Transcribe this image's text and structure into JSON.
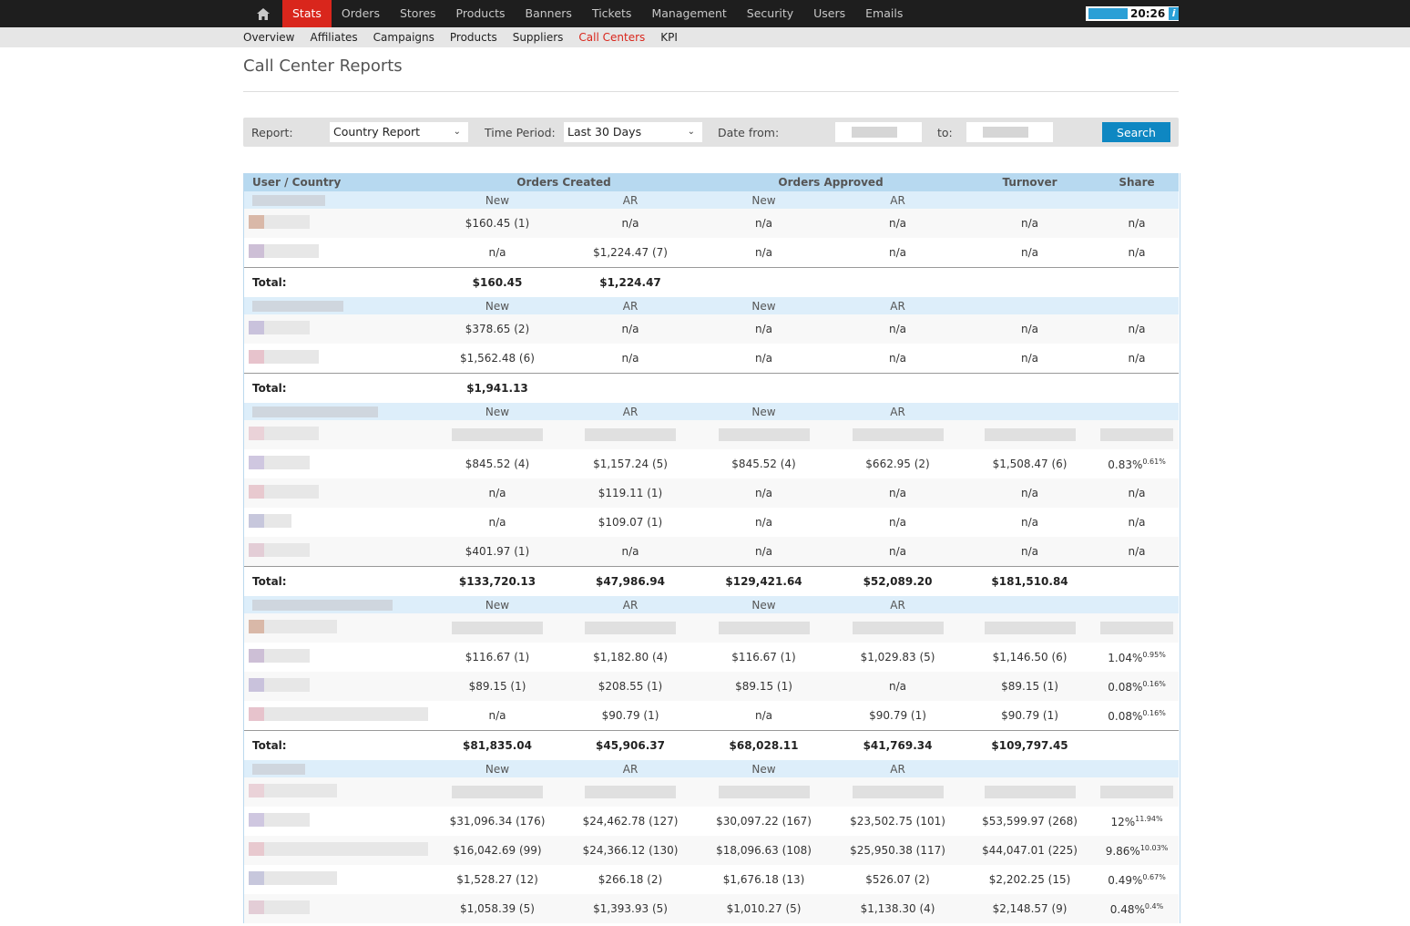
{
  "nav": {
    "items": [
      "Stats",
      "Orders",
      "Stores",
      "Products",
      "Banners",
      "Tickets",
      "Management",
      "Security",
      "Users",
      "Emails"
    ],
    "clock": "20:26",
    "info": "i"
  },
  "subnav": {
    "items": [
      "Overview",
      "Affiliates",
      "Campaigns",
      "Products",
      "Suppliers",
      "Call Centers",
      "KPI"
    ]
  },
  "page_title": "Call Center Reports",
  "filters": {
    "report_label": "Report:",
    "report_value": "Country Report",
    "period_label": "Time Period:",
    "period_value": "Last 30 Days",
    "date_from_label": "Date from:",
    "to_label": "to:",
    "search_label": "Search"
  },
  "table": {
    "headers": [
      "User / Country",
      "Orders Created",
      "Orders Approved",
      "Turnover",
      "Share"
    ],
    "sub_new": "New",
    "sub_ar": "AR",
    "total_label": "Total:",
    "groups": [
      {
        "rows": [
          {
            "c": [
              "$160.45 (1)",
              "n/a",
              "n/a",
              "n/a",
              "n/a",
              "n/a"
            ],
            "share_sup": ""
          },
          {
            "c": [
              "n/a",
              "$1,224.47 (7)",
              "n/a",
              "n/a",
              "n/a",
              "n/a"
            ],
            "share_sup": ""
          }
        ],
        "total": [
          "$160.45",
          "$1,224.47",
          "",
          "",
          ""
        ]
      },
      {
        "rows": [
          {
            "c": [
              "$378.65 (2)",
              "n/a",
              "n/a",
              "n/a",
              "n/a",
              "n/a"
            ],
            "share_sup": ""
          },
          {
            "c": [
              "$1,562.48 (6)",
              "n/a",
              "n/a",
              "n/a",
              "n/a",
              "n/a"
            ],
            "share_sup": ""
          }
        ],
        "total": [
          "$1,941.13",
          "",
          "",
          "",
          ""
        ]
      },
      {
        "rows": [
          {
            "c": [
              "$845.52 (4)",
              "$1,157.24 (5)",
              "$845.52 (4)",
              "$662.95 (2)",
              "$1,508.47 (6)",
              "0.83%"
            ],
            "share_sup": "0.61%"
          },
          {
            "c": [
              "n/a",
              "$119.11 (1)",
              "n/a",
              "n/a",
              "n/a",
              "n/a"
            ],
            "share_sup": ""
          },
          {
            "c": [
              "n/a",
              "$109.07 (1)",
              "n/a",
              "n/a",
              "n/a",
              "n/a"
            ],
            "share_sup": ""
          },
          {
            "c": [
              "$401.97 (1)",
              "n/a",
              "n/a",
              "n/a",
              "n/a",
              "n/a"
            ],
            "share_sup": ""
          }
        ],
        "total": [
          "$133,720.13",
          "$47,986.94",
          "$129,421.64",
          "$52,089.20",
          "$181,510.84"
        ]
      },
      {
        "rows": [
          {
            "c": [
              "$116.67 (1)",
              "$1,182.80 (4)",
              "$116.67 (1)",
              "$1,029.83 (5)",
              "$1,146.50 (6)",
              "1.04%"
            ],
            "share_sup": "0.95%"
          },
          {
            "c": [
              "$89.15 (1)",
              "$208.55 (1)",
              "$89.15 (1)",
              "n/a",
              "$89.15 (1)",
              "0.08%"
            ],
            "share_sup": "0.16%"
          },
          {
            "c": [
              "n/a",
              "$90.79 (1)",
              "n/a",
              "$90.79 (1)",
              "$90.79 (1)",
              "0.08%"
            ],
            "share_sup": "0.16%"
          }
        ],
        "total": [
          "$81,835.04",
          "$45,906.37",
          "$68,028.11",
          "$41,769.34",
          "$109,797.45"
        ]
      },
      {
        "rows": [
          {
            "c": [
              "$31,096.34 (176)",
              "$24,462.78 (127)",
              "$30,097.22 (167)",
              "$23,502.75 (101)",
              "$53,599.97 (268)",
              "12%"
            ],
            "share_sup": "11.94%"
          },
          {
            "c": [
              "$16,042.69 (99)",
              "$24,366.12 (130)",
              "$18,096.63 (108)",
              "$25,950.38 (117)",
              "$44,047.01 (225)",
              "9.86%"
            ],
            "share_sup": "10.03%"
          },
          {
            "c": [
              "$1,528.27 (12)",
              "$266.18 (2)",
              "$1,676.18 (13)",
              "$526.07 (2)",
              "$2,202.25 (15)",
              "0.49%"
            ],
            "share_sup": "0.67%"
          },
          {
            "c": [
              "$1,058.39 (5)",
              "$1,393.93 (5)",
              "$1,010.27 (5)",
              "$1,138.30 (4)",
              "$2,148.57 (9)",
              "0.48%"
            ],
            "share_sup": "0.4%"
          }
        ],
        "total": [
          "",
          "",
          "",
          "",
          ""
        ]
      }
    ]
  }
}
